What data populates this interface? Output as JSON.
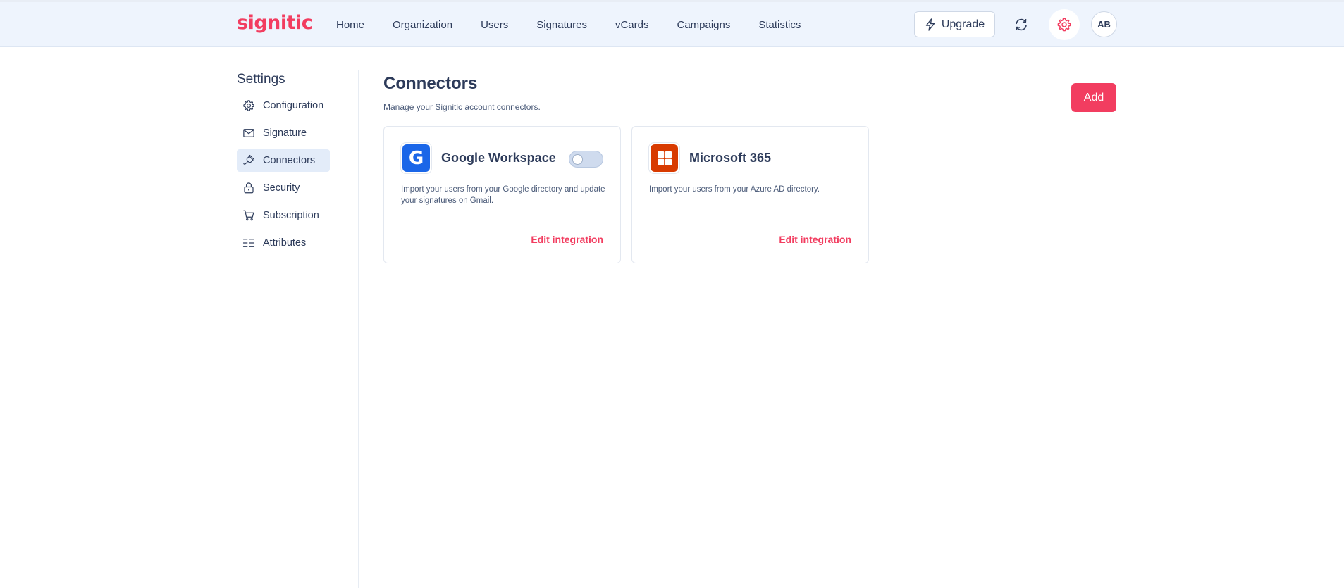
{
  "header": {
    "logo": "signitic",
    "nav": [
      {
        "label": "Home"
      },
      {
        "label": "Organization"
      },
      {
        "label": "Users"
      },
      {
        "label": "Signatures"
      },
      {
        "label": "vCards"
      },
      {
        "label": "Campaigns"
      },
      {
        "label": "Statistics"
      }
    ],
    "upgrade_label": "Upgrade",
    "avatar_initials": "AB"
  },
  "sidebar": {
    "title": "Settings",
    "items": [
      {
        "label": "Configuration",
        "icon": "gear-icon"
      },
      {
        "label": "Signature",
        "icon": "mail-icon"
      },
      {
        "label": "Connectors",
        "icon": "plug-icon",
        "active": true
      },
      {
        "label": "Security",
        "icon": "lock-icon"
      },
      {
        "label": "Subscription",
        "icon": "cart-icon"
      },
      {
        "label": "Attributes",
        "icon": "list-icon"
      }
    ]
  },
  "main": {
    "title": "Connectors",
    "subtitle": "Manage your Signitic account connectors.",
    "add_label": "Add",
    "connectors": [
      {
        "name": "Google Workspace",
        "logo_letter": "G",
        "description": "Import your users from your Google directory and update your signatures on Gmail.",
        "enabled": false,
        "link_label": "Edit integration"
      },
      {
        "name": "Microsoft 365",
        "description": "Import your users from your Azure AD directory.",
        "link_label": "Edit integration"
      }
    ]
  },
  "colors": {
    "accent": "#f23d60",
    "topbar_bg": "#eef4fd",
    "text": "#2d3b5a",
    "google_blue": "#1a66e8",
    "ms_red": "#d83b01"
  }
}
